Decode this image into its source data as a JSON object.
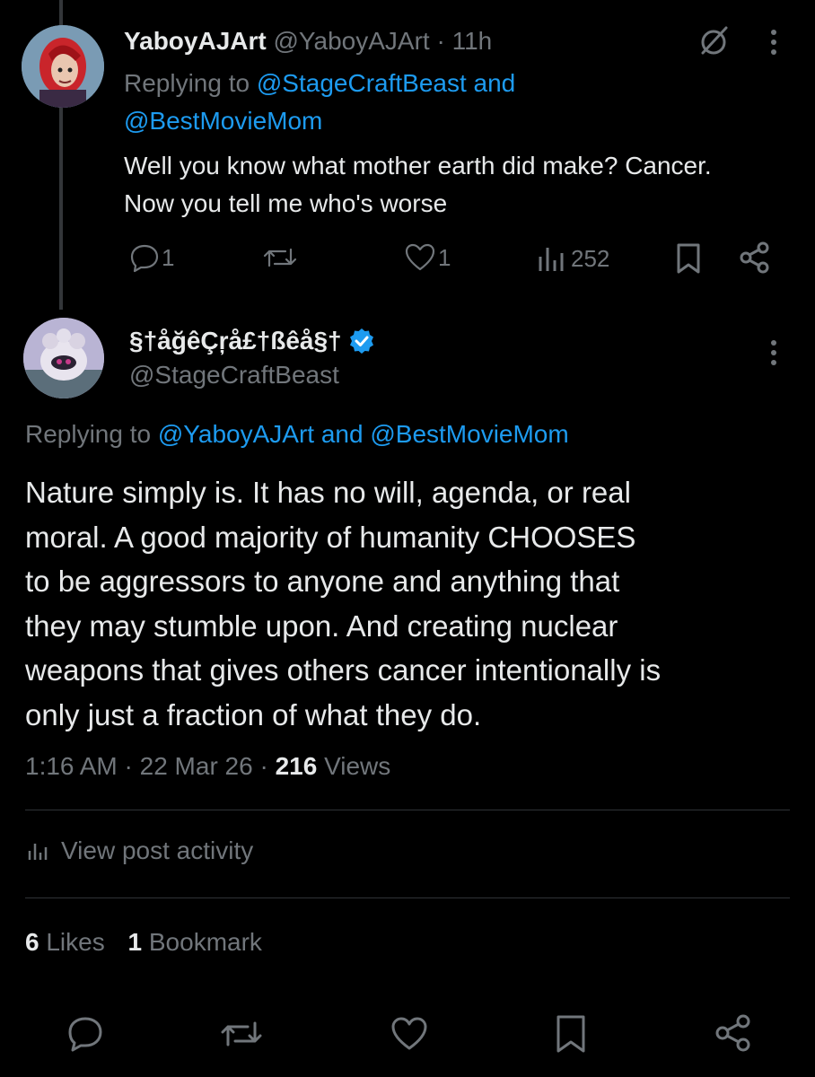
{
  "reply_tweet": {
    "display_name": "YaboyAJArt",
    "handle": "@YaboyAJArt",
    "separator": "·",
    "time": "11h",
    "replying_prefix": "Replying to",
    "replying_line1": "@StageCraftBeast and",
    "replying_line2": "@BestMovieMom",
    "text_line1": "Well you know what mother earth did make? Cancer.",
    "text_line2": "Now you tell me who's worse",
    "actions": {
      "reply_count": "1",
      "repost_count": "",
      "like_count": "1",
      "views_count": "252"
    }
  },
  "main_tweet": {
    "display_name": "§†åğêÇŗå£†ßêå§†",
    "handle": "@StageCraftBeast",
    "replying_prefix": "Replying to",
    "replying_mentions": "@YaboyAJArt and @BestMovieMom",
    "text_lines": [
      "Nature simply is. It has no will, agenda, or real",
      "moral. A good majority of humanity CHOOSES",
      "to be aggressors to anyone and anything that",
      "they may stumble upon. And creating nuclear",
      "weapons that gives others cancer intentionally is",
      "only just a fraction of what they do."
    ],
    "time": "1:16 AM",
    "date": "22 Mar 26",
    "separator": "·",
    "views_count": "216",
    "views_label": "Views",
    "view_activity_label": "View post activity",
    "likes_count": "6",
    "likes_label": "Likes",
    "bookmarks_count": "1",
    "bookmarks_label": "Bookmark"
  },
  "colors": {
    "background": "#000000",
    "text": "#e7e9ea",
    "muted": "#71767b",
    "link": "#1d9bf0",
    "verified": "#1d9bf0",
    "divider": "#2f3336"
  },
  "icons": [
    "grok-icon",
    "more-icon",
    "reply-icon",
    "repost-icon",
    "like-icon",
    "views-icon",
    "bookmark-icon",
    "share-icon",
    "verified-badge-icon",
    "analytics-icon"
  ]
}
